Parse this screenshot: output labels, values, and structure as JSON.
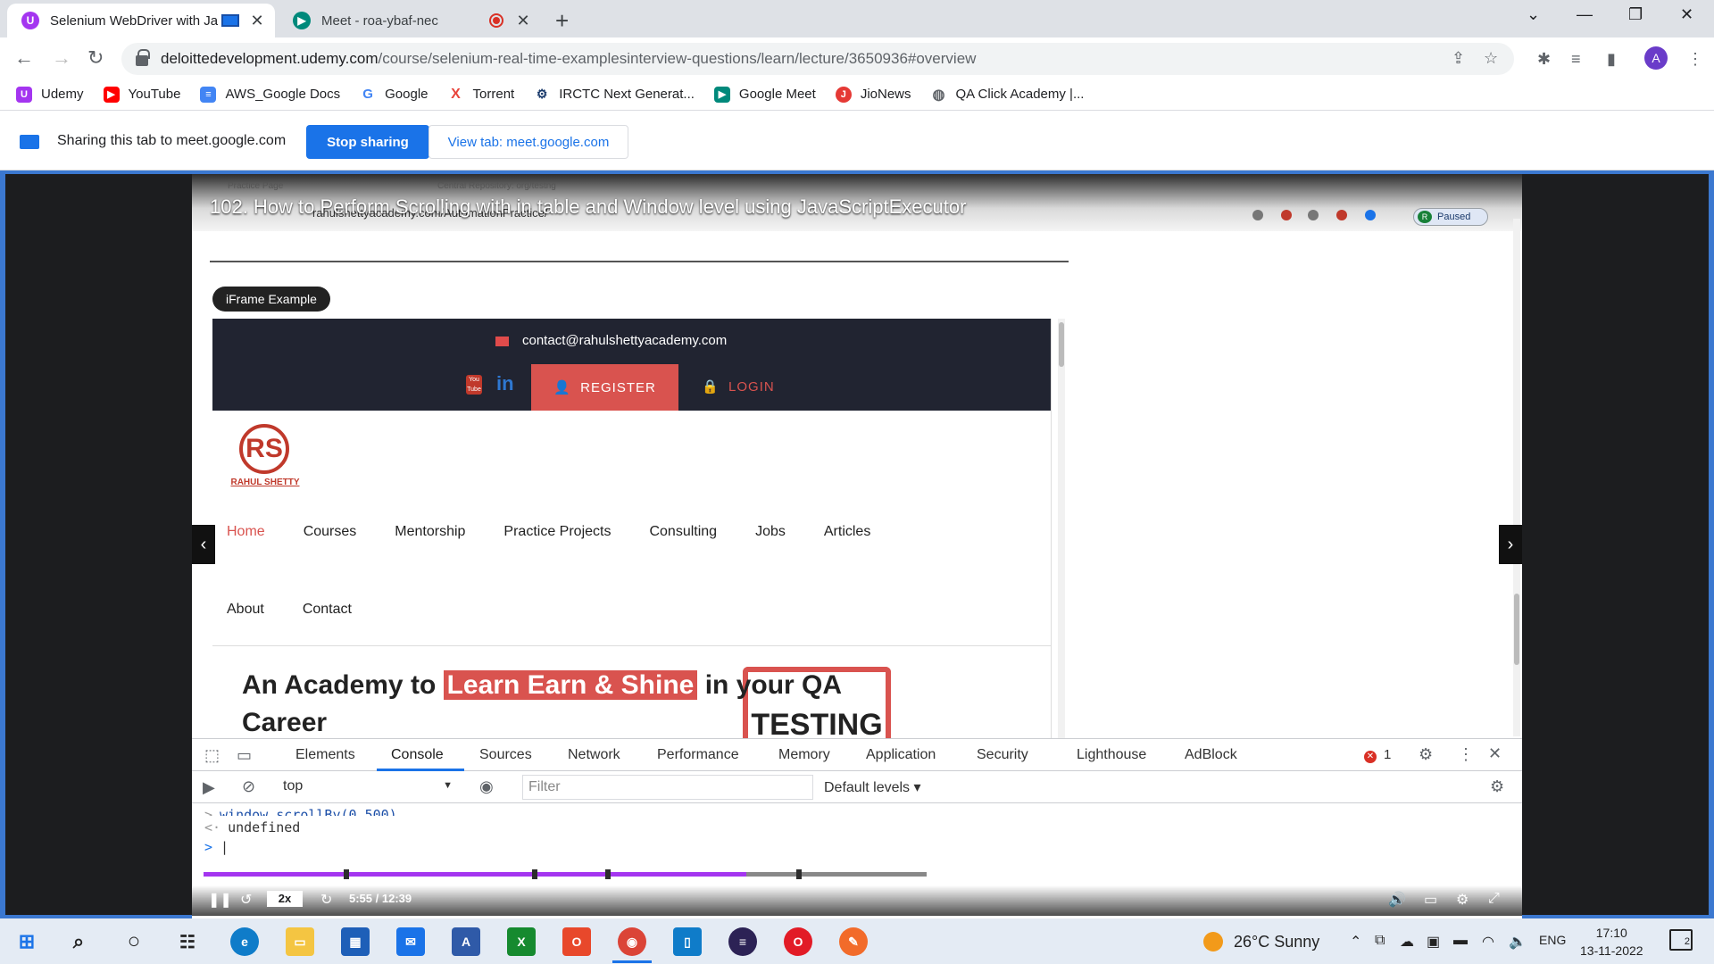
{
  "browser": {
    "tabs": [
      {
        "title": "Selenium WebDriver with Ja",
        "favicon": "udemy-icon",
        "active": true
      },
      {
        "title": "Meet - roa-ybaf-nec",
        "favicon": "google-meet-icon",
        "active": false
      }
    ],
    "url_domain": "deloittedevelopment.udemy.com",
    "url_path": "/course/selenium-real-time-examplesinterview-questions/learn/lecture/3650936#overview",
    "profile_initial": "A"
  },
  "bookmarks": [
    {
      "label": "Udemy",
      "icon": "udemy-icon",
      "color": "#a435f0"
    },
    {
      "label": "YouTube",
      "icon": "youtube-icon",
      "color": "#ff0000"
    },
    {
      "label": "AWS_Google Docs",
      "icon": "docs-icon",
      "color": "#4285f4"
    },
    {
      "label": "Google",
      "icon": "google-icon",
      "color": "#ffffff"
    },
    {
      "label": "Torrent",
      "icon": "torrent-icon",
      "color": "#e8453c"
    },
    {
      "label": "IRCTC Next Generat...",
      "icon": "irctc-icon",
      "color": "#ffffff"
    },
    {
      "label": "Google Meet",
      "icon": "google-meet-icon",
      "color": "#00897b"
    },
    {
      "label": "JioNews",
      "icon": "jionews-icon",
      "color": "#e53935"
    },
    {
      "label": "QA Click Academy |...",
      "icon": "globe-icon",
      "color": "#ffffff"
    }
  ],
  "sharing": {
    "text": "Sharing this tab to meet.google.com",
    "stop_label": "Stop sharing",
    "view_label": "View tab: meet.google.com"
  },
  "video": {
    "title": "102. How to Perform Scrolling with in table and Window level using JavaScriptExecutor",
    "inner_tabs": [
      "Practice Page",
      "Central Repository: org/testng"
    ],
    "inner_url": "rahulshettyacademy.com/AutomationPractice/",
    "paused_label": "Paused",
    "iframe_label": "iFrame Example",
    "contact_email": "contact@rahulshettyacademy.com",
    "register_label": "REGISTER",
    "login_label": "LOGIN",
    "logo_text": "RAHUL SHETTY",
    "nav_row1": [
      "Home",
      "Courses",
      "Mentorship",
      "Practice Projects",
      "Consulting",
      "Jobs",
      "Articles"
    ],
    "nav_row2": [
      "About",
      "Contact"
    ],
    "hero_before": "An Academy to ",
    "hero_highlight": "Learn Earn & Shine",
    "hero_after": "  in your QA",
    "hero_line2": "Career",
    "art_text": "TESTING",
    "speed": "2x",
    "time": "5:55 / 12:39",
    "progress_fraction": 0.75
  },
  "devtools": {
    "tabs": [
      "Elements",
      "Console",
      "Sources",
      "Network",
      "Performance",
      "Memory",
      "Application",
      "Security",
      "Lighthouse",
      "AdBlock"
    ],
    "active_tab": "Console",
    "error_count": "1",
    "context": "top",
    "filter_placeholder": "Filter",
    "levels": "Default levels",
    "partial_line": "window.scrollBy(0,500)",
    "result": "undefined",
    "prompt": ">"
  },
  "taskbar": {
    "weather": "26°C  Sunny",
    "lang": "ENG",
    "time": "17:10",
    "date": "13-11-2022",
    "notifications": "2"
  }
}
